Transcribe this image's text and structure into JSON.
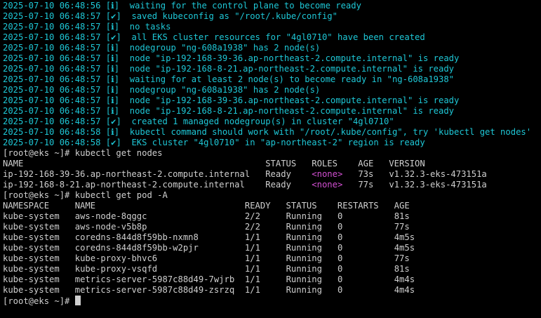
{
  "log_lines": [
    {
      "ts": "2025-07-10 06:48:56",
      "mark": "[ℹ]",
      "msg": "  waiting for the control plane to become ready"
    },
    {
      "ts": "2025-07-10 06:48:57",
      "mark": "[✔]",
      "msg": "  saved kubeconfig as \"/root/.kube/config\""
    },
    {
      "ts": "2025-07-10 06:48:57",
      "mark": "[ℹ]",
      "msg": "  no tasks"
    },
    {
      "ts": "2025-07-10 06:48:57",
      "mark": "[✔]",
      "msg": "  all EKS cluster resources for \"4gl0710\" have been created"
    },
    {
      "ts": "2025-07-10 06:48:57",
      "mark": "[ℹ]",
      "msg": "  nodegroup \"ng-608a1938\" has 2 node(s)"
    },
    {
      "ts": "2025-07-10 06:48:57",
      "mark": "[ℹ]",
      "msg": "  node \"ip-192-168-39-36.ap-northeast-2.compute.internal\" is ready"
    },
    {
      "ts": "2025-07-10 06:48:57",
      "mark": "[ℹ]",
      "msg": "  node \"ip-192-168-8-21.ap-northeast-2.compute.internal\" is ready"
    },
    {
      "ts": "2025-07-10 06:48:57",
      "mark": "[ℹ]",
      "msg": "  waiting for at least 2 node(s) to become ready in \"ng-608a1938\""
    },
    {
      "ts": "2025-07-10 06:48:57",
      "mark": "[ℹ]",
      "msg": "  nodegroup \"ng-608a1938\" has 2 node(s)"
    },
    {
      "ts": "2025-07-10 06:48:57",
      "mark": "[ℹ]",
      "msg": "  node \"ip-192-168-39-36.ap-northeast-2.compute.internal\" is ready"
    },
    {
      "ts": "2025-07-10 06:48:57",
      "mark": "[ℹ]",
      "msg": "  node \"ip-192-168-8-21.ap-northeast-2.compute.internal\" is ready"
    },
    {
      "ts": "2025-07-10 06:48:57",
      "mark": "[✔]",
      "msg": "  created 1 managed nodegroup(s) in cluster \"4gl0710\""
    },
    {
      "ts": "2025-07-10 06:48:58",
      "mark": "[ℹ]",
      "msg": "  kubectl command should work with \"/root/.kube/config\", try 'kubectl get nodes'"
    },
    {
      "ts": "2025-07-10 06:48:58",
      "mark": "[✔]",
      "msg": "  EKS cluster \"4gl0710\" in \"ap-northeast-2\" region is ready"
    }
  ],
  "prompt": "[root@eks ~]#",
  "cmd1": " kubectl get nodes",
  "nodes_header": "NAME                                               STATUS   ROLES    AGE   VERSION",
  "nodes": [
    {
      "name": "ip-192-168-39-36.ap-northeast-2.compute.internal",
      "status": "Ready",
      "roles": "<none>",
      "age": "73s",
      "version": "v1.32.3-eks-473151a"
    },
    {
      "name": "ip-192-168-8-21.ap-northeast-2.compute.internal",
      "status": "Ready",
      "roles": "<none>",
      "age": "77s",
      "version": "v1.32.3-eks-473151a"
    }
  ],
  "cmd2": " kubectl get pod -A",
  "pods_header": "NAMESPACE     NAME                             READY   STATUS    RESTARTS   AGE",
  "pods": [
    {
      "ns": "kube-system",
      "name": "aws-node-8qggc",
      "ready": "2/2",
      "status": "Running",
      "restarts": "0",
      "age": "81s"
    },
    {
      "ns": "kube-system",
      "name": "aws-node-v5b8p",
      "ready": "2/2",
      "status": "Running",
      "restarts": "0",
      "age": "77s"
    },
    {
      "ns": "kube-system",
      "name": "coredns-844d8f59bb-nxmn8",
      "ready": "1/1",
      "status": "Running",
      "restarts": "0",
      "age": "4m5s"
    },
    {
      "ns": "kube-system",
      "name": "coredns-844d8f59bb-w2pjr",
      "ready": "1/1",
      "status": "Running",
      "restarts": "0",
      "age": "4m5s"
    },
    {
      "ns": "kube-system",
      "name": "kube-proxy-bhvc6",
      "ready": "1/1",
      "status": "Running",
      "restarts": "0",
      "age": "77s"
    },
    {
      "ns": "kube-system",
      "name": "kube-proxy-vsqfd",
      "ready": "1/1",
      "status": "Running",
      "restarts": "0",
      "age": "81s"
    },
    {
      "ns": "kube-system",
      "name": "metrics-server-5987c88d49-7wjrb",
      "ready": "1/1",
      "status": "Running",
      "restarts": "0",
      "age": "4m4s"
    },
    {
      "ns": "kube-system",
      "name": "metrics-server-5987c88d49-zsrzq",
      "ready": "1/1",
      "status": "Running",
      "restarts": "0",
      "age": "4m4s"
    }
  ],
  "colors": {
    "log": "#1ec7d6",
    "text": "#cfcfcf",
    "none": "#d24fd2",
    "background": "#000000"
  }
}
